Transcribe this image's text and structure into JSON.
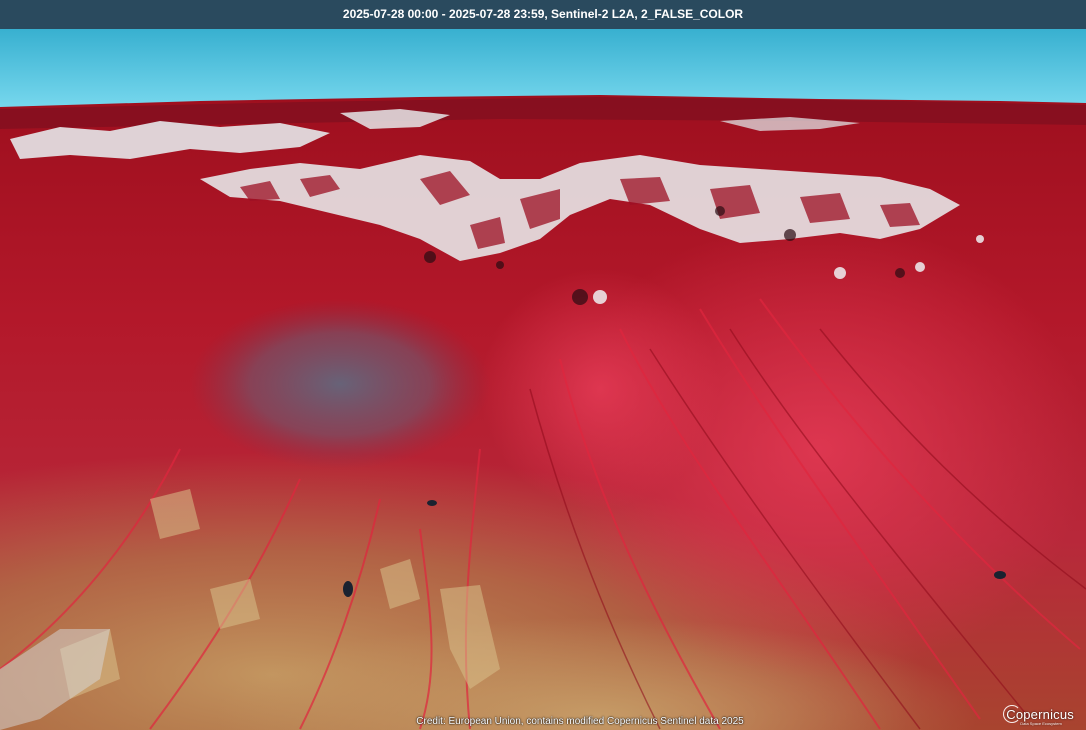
{
  "header": {
    "title": "2025-07-28 00:00 - 2025-07-28 23:59, Sentinel-2 L2A, 2_FALSE_COLOR"
  },
  "footer": {
    "credit": "Credit: European Union, contains modified Copernicus Sentinel data 2025"
  },
  "logo": {
    "name": "Copernicus",
    "subtitle": "Data Space Ecosystem"
  },
  "colors": {
    "title_bar": "#2a4a5e",
    "sky_top": "#3fb6d4",
    "sky_bottom": "#6fd3ea",
    "vegetation_red": "#c8162c",
    "snow": "#e8eaec",
    "bare_soil": "#b98a52"
  }
}
